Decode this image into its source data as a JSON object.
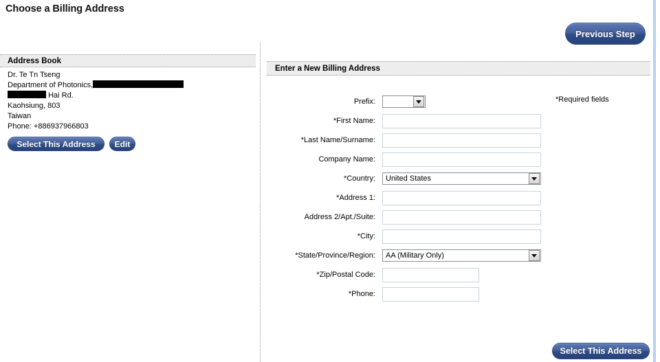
{
  "page": {
    "title": "Choose a Billing Address"
  },
  "toolbar": {
    "previous_step_label": "Previous Step",
    "bottom_select_label": "Select This Address"
  },
  "address_book": {
    "header": "Address Book",
    "entry": {
      "name": "Dr. Te Tn Tseng",
      "line2_prefix": "Department of Photonics,",
      "line2_redacted": true,
      "line3_redacted": true,
      "line3_suffix": "Hai Rd.",
      "city_zip": "Kaohsiung, 803",
      "country": "Taiwan",
      "phone": "Phone: +886937966803"
    },
    "select_label": "Select This Address",
    "edit_label": "Edit"
  },
  "new_address": {
    "header": "Enter a New Billing Address",
    "required_note": "*Required fields",
    "fields": [
      {
        "label": "Prefix:",
        "control": "select",
        "value": "",
        "size": "small"
      },
      {
        "label": "*First Name:",
        "control": "text",
        "value": "",
        "size": "wide"
      },
      {
        "label": "*Last Name/Surname:",
        "control": "text",
        "value": "",
        "size": "wide"
      },
      {
        "label": "Company Name:",
        "control": "text",
        "value": "",
        "size": "wide"
      },
      {
        "label": "*Country:",
        "control": "select",
        "value": "United States",
        "size": "wide"
      },
      {
        "label": "*Address 1:",
        "control": "text",
        "value": "",
        "size": "wide"
      },
      {
        "label": "Address 2/Apt./Suite:",
        "control": "text",
        "value": "",
        "size": "wide"
      },
      {
        "label": "*City:",
        "control": "text",
        "value": "",
        "size": "wide"
      },
      {
        "label": "*State/Province/Region:",
        "control": "select",
        "value": "AA (Military Only)",
        "size": "wide"
      },
      {
        "label": "*Zip/Postal Code:",
        "control": "text",
        "value": "",
        "size": "short"
      },
      {
        "label": "*Phone:",
        "control": "text",
        "value": "",
        "size": "short"
      }
    ]
  },
  "colors": {
    "button_blue_top": "#5b79b8",
    "button_blue_bottom": "#27427a",
    "panel_header_bg": "#ededed",
    "input_border": "#c9d3dd",
    "right_rail": "#b5d3ef"
  }
}
